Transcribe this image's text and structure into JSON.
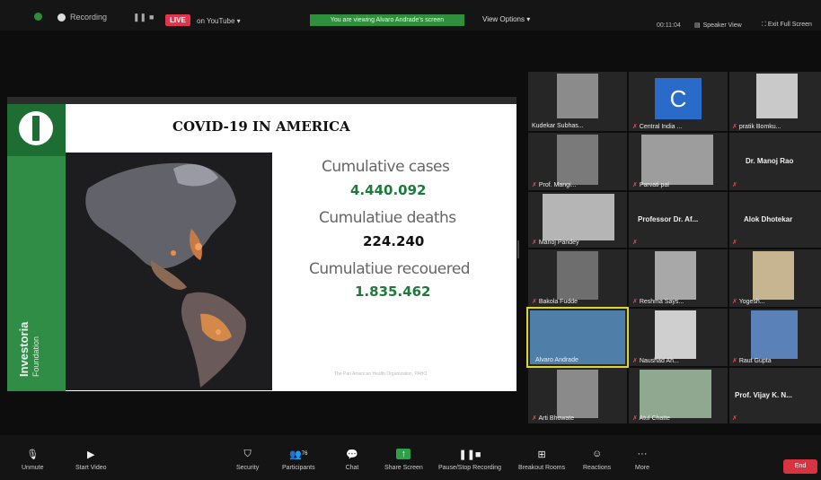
{
  "topbar": {
    "recording": "Recording",
    "live": "LIVE",
    "live_target": "on YouTube ▾",
    "viewing_banner": "You are viewing Alvaro Andrade's screen",
    "view_options": "View Options ▾",
    "timer": "00:11:04",
    "speaker_view": "Speaker View",
    "exit_fullscreen": "Exit Full Screen"
  },
  "slide": {
    "title": "COVID-19 IN AMERICA",
    "brand_name": "Investoria",
    "brand_sub": "Foundation",
    "stats": [
      {
        "label": "Cumulative cases",
        "value": "4.440.092",
        "color": "#1e7a3c"
      },
      {
        "label": "Cumulatiue deaths",
        "value": "224.240",
        "color": "#111111"
      },
      {
        "label": "Cumulatiue recouered",
        "value": "1.835.462",
        "color": "#1e7a3c"
      }
    ],
    "footnote": "The Pan American Health Organization, PAHO"
  },
  "participants": [
    {
      "name": "Kudekar Subhas..."
    },
    {
      "name": "Central India ..."
    },
    {
      "name": "pratik Bomku..."
    },
    {
      "name": "Prof. Mangi..."
    },
    {
      "name": "Parvati pal"
    },
    {
      "name": "Dr. Manoj Rao"
    },
    {
      "name": "Manoj Pandey"
    },
    {
      "name": "Professor Dr. Af..."
    },
    {
      "name": "Alok Dhotekar"
    },
    {
      "name": "Bakola Fudde"
    },
    {
      "name": "Reshma Says..."
    },
    {
      "name": "Yogesh..."
    },
    {
      "name": "Alvaro Andrade"
    },
    {
      "name": "Naushad Ah..."
    },
    {
      "name": "Raut Gupta"
    },
    {
      "name": "Arti Bhowate"
    },
    {
      "name": "Atul Chatte"
    },
    {
      "name": "Prof. Vijay K. N..."
    }
  ],
  "toolbar": {
    "unmute": "Unmute",
    "start_video": "Start Video",
    "security": "Security",
    "participants": "Participants",
    "participant_count": "76",
    "chat": "Chat",
    "share_screen": "Share Screen",
    "pause_recording": "Pause/Stop Recording",
    "breakout": "Breakout Rooms",
    "reactions": "Reactions",
    "more": "More",
    "end": "End"
  },
  "colors": {
    "accent_green": "#2f8d46",
    "live_red": "#e0364c",
    "end_red": "#d63440"
  }
}
